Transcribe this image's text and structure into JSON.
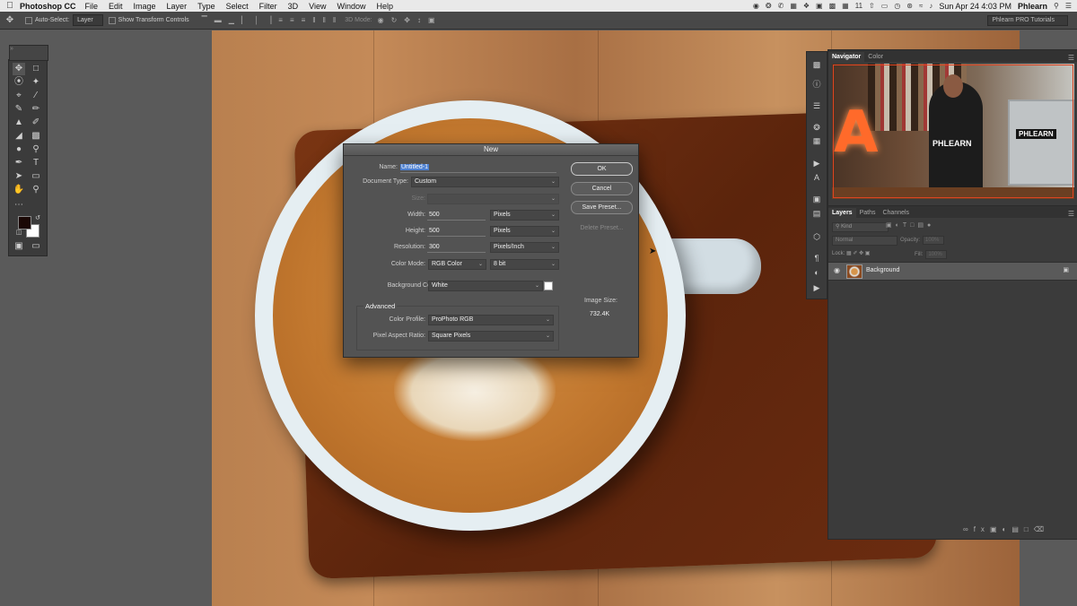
{
  "menubar": {
    "app_name": "Photoshop CC",
    "items": [
      "File",
      "Edit",
      "Image",
      "Layer",
      "Type",
      "Select",
      "Filter",
      "3D",
      "View",
      "Window",
      "Help"
    ],
    "status_icons": [
      "record-icon",
      "compass-icon",
      "phone-icon",
      "evernote-icon",
      "dropbox-icon",
      "image-icon",
      "messages-icon",
      "calendar-icon",
      "upload-icon",
      "screen-icon",
      "timemachine-icon",
      "bluetooth-icon",
      "wifi-icon",
      "volume-icon"
    ],
    "badge": "11",
    "datetime": "Sun Apr 24  4:03 PM",
    "user": "Phlearn"
  },
  "options_bar": {
    "auto_select_label": "Auto-Select:",
    "auto_select_value": "Layer",
    "transform_label": "Show Transform Controls",
    "mode_3d_label": "3D Mode:",
    "workspace": "Phlearn PRO Tutorials"
  },
  "dialog": {
    "title": "New",
    "name_label": "Name:",
    "name_value": "Untitled-1",
    "doc_type_label": "Document Type:",
    "doc_type_value": "Custom",
    "size_label": "Size:",
    "width_label": "Width:",
    "width_value": "500",
    "width_unit": "Pixels",
    "height_label": "Height:",
    "height_value": "500",
    "height_unit": "Pixels",
    "resolution_label": "Resolution:",
    "resolution_value": "300",
    "resolution_unit": "Pixels/Inch",
    "color_mode_label": "Color Mode:",
    "color_mode_value": "RGB Color",
    "bit_depth": "8 bit",
    "bg_contents_label": "Background Contents:",
    "bg_contents_value": "White",
    "advanced_label": "Advanced",
    "color_profile_label": "Color Profile:",
    "color_profile_value": "ProPhoto RGB",
    "pixel_aspect_label": "Pixel Aspect Ratio:",
    "pixel_aspect_value": "Square Pixels",
    "ok_label": "OK",
    "cancel_label": "Cancel",
    "save_preset_label": "Save Preset...",
    "delete_preset_label": "Delete Preset...",
    "image_size_label": "Image Size:",
    "image_size_value": "732.4K"
  },
  "navigator": {
    "tabs": [
      "Navigator",
      "Color"
    ],
    "preview_text_a": "A",
    "preview_shirt": "PHLEARN",
    "preview_monitor": "PHLEARN"
  },
  "layers": {
    "tabs": [
      "Layers",
      "Paths",
      "Channels"
    ],
    "kind_label": "Kind",
    "blend_mode": "Normal",
    "opacity_label": "Opacity:",
    "opacity_value": "100%",
    "lock_label": "Lock:",
    "fill_label": "Fill:",
    "fill_value": "100%",
    "layer_name": "Background"
  },
  "colors": {
    "foreground": "#1a0805",
    "background": "#ffffff",
    "selection": "#4c7fd0"
  }
}
